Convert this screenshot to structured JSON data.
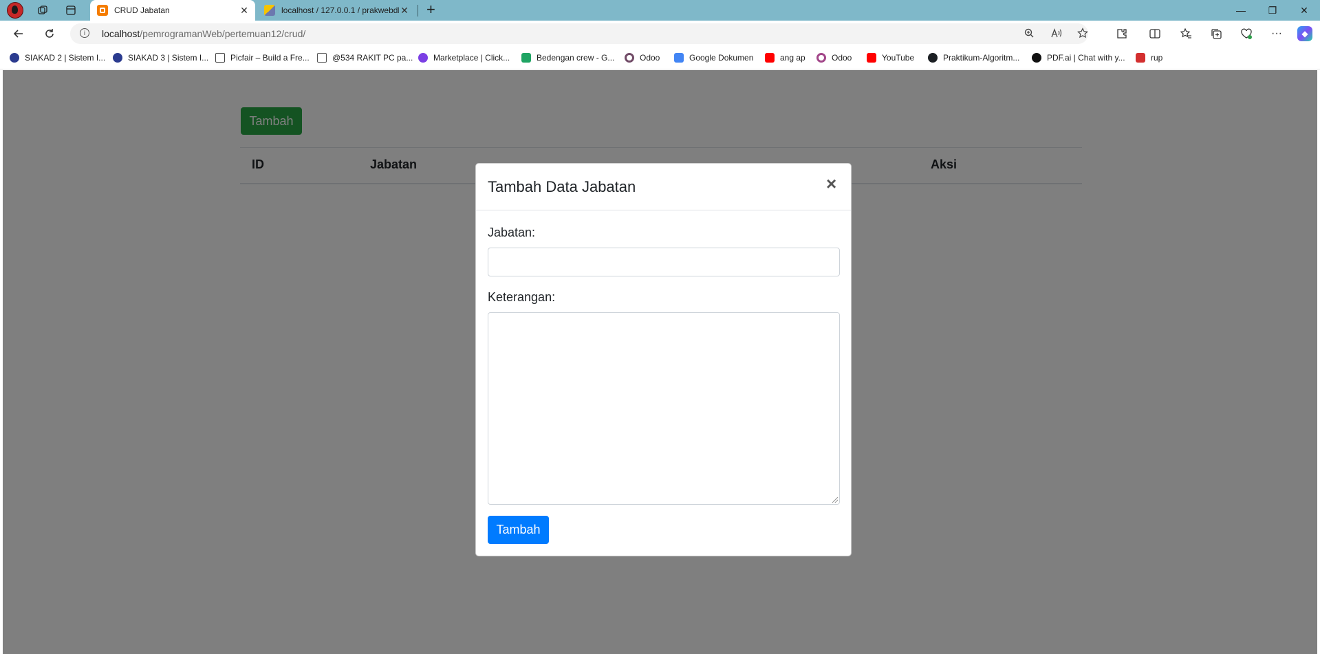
{
  "browser": {
    "tabs": [
      {
        "title": "CRUD Jabatan",
        "active": true
      },
      {
        "title": "localhost / 127.0.0.1 / prakwebdb",
        "active": false
      }
    ],
    "new_tab_label": "+",
    "window_controls": {
      "minimize": "—",
      "restore": "❐",
      "close": "✕"
    },
    "address": {
      "host": "localhost",
      "path": "/pemrogramanWeb/pertemuan12/crud/"
    },
    "bookmarks": [
      {
        "label": "SIAKAD 2 | Sistem I...",
        "icon": "crest-icon",
        "color": "#2b3b8f"
      },
      {
        "label": "SIAKAD 3 | Sistem I...",
        "icon": "crest-icon",
        "color": "#2b3b8f"
      },
      {
        "label": "Picfair – Build a Fre...",
        "icon": "frame-icon",
        "color": "#444444"
      },
      {
        "label": "@534 RAKIT PC pa...",
        "icon": "page-icon",
        "color": "#555555"
      },
      {
        "label": "Marketplace | Click...",
        "icon": "spiral-icon",
        "color": "#7b3fe4"
      },
      {
        "label": "Bedengan crew - G...",
        "icon": "drive-icon",
        "color": "#1fa463"
      },
      {
        "label": "Odoo",
        "icon": "odoo-icon",
        "color": "#714b67"
      },
      {
        "label": "Google Dokumen",
        "icon": "docs-icon",
        "color": "#4285f4"
      },
      {
        "label": "ang ap",
        "icon": "youtube-icon",
        "color": "#ff0000"
      },
      {
        "label": "Odoo",
        "icon": "odoo-icon",
        "color": "#a24689"
      },
      {
        "label": "YouTube",
        "icon": "youtube-icon",
        "color": "#ff0000"
      },
      {
        "label": "Praktikum-Algoritm...",
        "icon": "github-icon",
        "color": "#1b1f23"
      },
      {
        "label": "PDF.ai | Chat with y...",
        "icon": "pdfai-icon",
        "color": "#111111"
      },
      {
        "label": "rup",
        "icon": "pdf-icon",
        "color": "#d32f2f"
      }
    ]
  },
  "page": {
    "add_button_label": "Tambah",
    "table_headers": [
      "ID",
      "Jabatan",
      "Aksi"
    ]
  },
  "modal": {
    "title": "Tambah Data Jabatan",
    "close_symbol": "×",
    "jabatan_label": "Jabatan:",
    "jabatan_value": "",
    "keterangan_label": "Keterangan:",
    "keterangan_value": "",
    "submit_label": "Tambah"
  },
  "colors": {
    "tab_strip": "#7fb8c9",
    "success": "#28a745",
    "primary": "#007bff",
    "backdrop": "rgba(0,0,0,0.5)"
  }
}
